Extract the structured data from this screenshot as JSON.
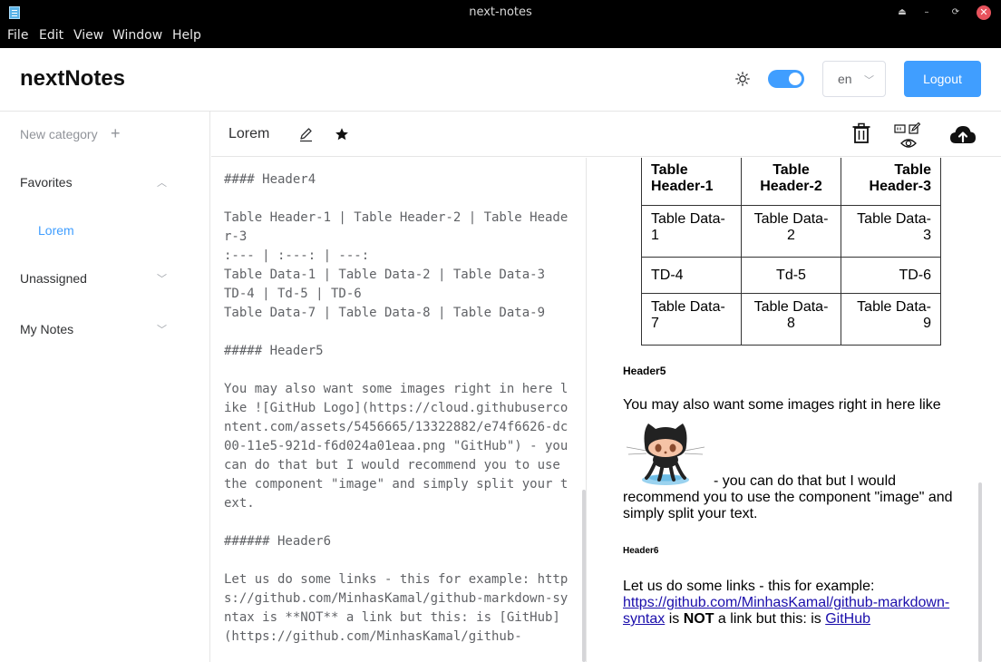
{
  "window": {
    "title": "next-notes",
    "controls": {
      "minimize_up": "⏏",
      "minimize": "–",
      "restore": "⟳",
      "close": "✕"
    }
  },
  "menu": [
    "File",
    "Edit",
    "View",
    "Window",
    "Help"
  ],
  "header": {
    "brand": "nextNotes",
    "theme_toggle_on": true,
    "language": "en",
    "logout_label": "Logout",
    "accent": "#409eff"
  },
  "sidebar": {
    "new_category": "New category",
    "items": [
      {
        "label": "Favorites",
        "expanded": true
      },
      {
        "label": "Unassigned",
        "expanded": false
      },
      {
        "label": "My Notes",
        "expanded": false
      }
    ],
    "favorites_children": [
      "Lorem"
    ]
  },
  "toolbar": {
    "note_title": "Lorem"
  },
  "editor": {
    "text": "#### Header4\n\nTable Header-1 | Table Header-2 | Table Header-3\n:--- | :---: | ---:\nTable Data-1 | Table Data-2 | Table Data-3\nTD-4 | Td-5 | TD-6\nTable Data-7 | Table Data-8 | Table Data-9\n\n##### Header5\n\nYou may also want some images right in here like ![GitHub Logo](https://cloud.githubusercontent.com/assets/5456665/13322882/e74f6626-dc00-11e5-921d-f6d024a01eaa.png \"GitHub\") - you can do that but I would recommend you to use the component \"image\" and simply split your text.\n\n###### Header6\n\nLet us do some links - this for example: https://github.com/MinhasKamal/github-markdown-syntax is **NOT** a link but this: is [GitHub](https://github.com/MinhasKamal/github-"
  },
  "preview": {
    "table": {
      "headers": [
        "Table Header-1",
        "Table Header-2",
        "Table Header-3"
      ],
      "rows": [
        [
          "Table Data-1",
          "Table Data-2",
          "Table Data-3"
        ],
        [
          "TD-4",
          "Td-5",
          "TD-6"
        ],
        [
          "Table Data-7",
          "Table Data-8",
          "Table Data-9"
        ]
      ]
    },
    "header5": "Header5",
    "para1_start": "You may also want some images right in here like",
    "para1_end": "- you can do that but I would recommend you to use the component \"image\" and simply split your text.",
    "header6": "Header6",
    "para2_start": "Let us do some links - this for example: ",
    "link1": "https://github.com/MinhasKamal/github-markdown-syntax",
    "para2_mid1": " is ",
    "bold_not": "NOT",
    "para2_mid2": " a link but this: is ",
    "link2": "GitHub"
  }
}
